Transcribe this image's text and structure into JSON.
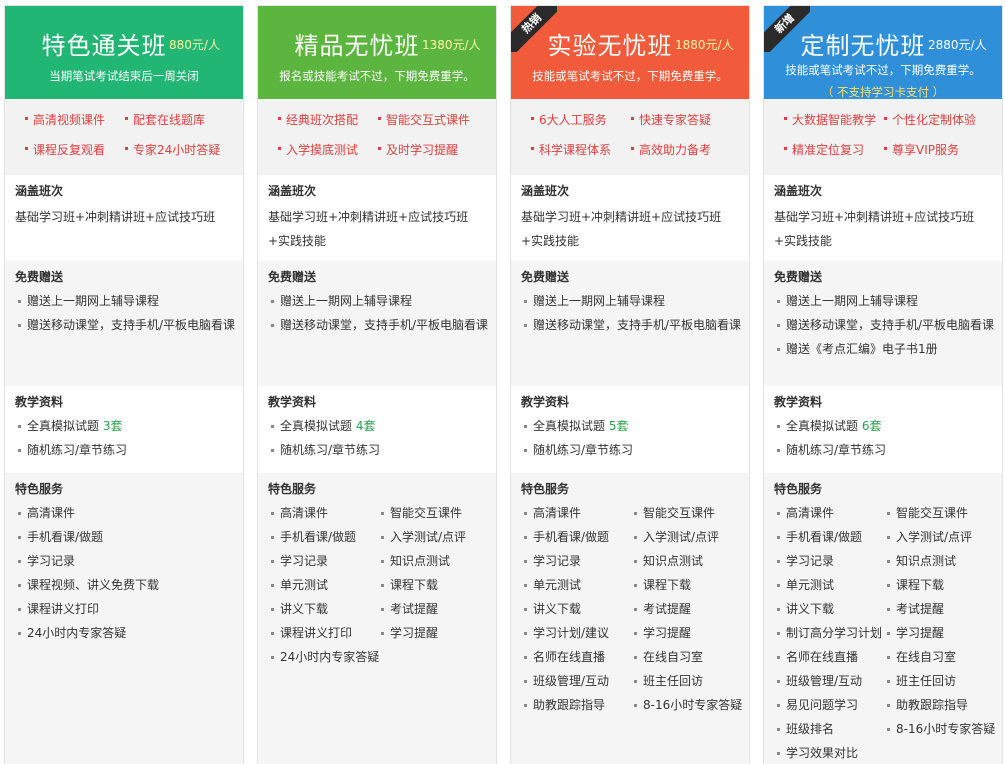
{
  "columns": [
    {
      "title": "特色通关班",
      "price": "880元/人",
      "subtitle": "当期笔试考试结束后一周关闭",
      "subtitle2": "",
      "ribbon": "",
      "features": [
        "高清视频课件",
        "配套在线题库",
        "课程反复观看",
        "专家24小时答疑"
      ],
      "cover_title": "涵盖班次",
      "cover_text": "基础学习班+冲刺精讲班+应试技巧班",
      "gift_title": "免费赠送",
      "gifts": [
        "赠送上一期网上辅导课程",
        "赠送移动课堂，支持手机/平板电脑看课"
      ],
      "material_title": "教学资料",
      "material_1_prefix": "全真模拟试题 ",
      "material_1_count": "3套",
      "material_2": "随机练习/章节练习",
      "service_title": "特色服务",
      "services_left": [
        "高清课件",
        "手机看课/做题",
        "学习记录",
        "课程视频、讲义免费下载",
        "课程讲义打印",
        "24小时内专家答疑"
      ],
      "services_right": []
    },
    {
      "title": "精品无忧班",
      "price": "1380元/人",
      "subtitle": "报名或技能考试不过，下期免费重学。",
      "subtitle2": "",
      "ribbon": "",
      "features": [
        "经典班次搭配",
        "智能交互式课件",
        "入学摸底测试",
        "及时学习提醒"
      ],
      "cover_title": "涵盖班次",
      "cover_text": "基础学习班+冲刺精讲班+应试技巧班+实践技能",
      "gift_title": "免费赠送",
      "gifts": [
        "赠送上一期网上辅导课程",
        "赠送移动课堂，支持手机/平板电脑看课"
      ],
      "material_title": "教学资料",
      "material_1_prefix": "全真模拟试题 ",
      "material_1_count": "4套",
      "material_2": "随机练习/章节练习",
      "service_title": "特色服务",
      "services_left": [
        "高清课件",
        "手机看课/做题",
        "学习记录",
        "单元测试",
        "讲义下载",
        "课程讲义打印",
        "24小时内专家答疑"
      ],
      "services_right": [
        "智能交互课件",
        "入学测试/点评",
        "知识点测试",
        "课程下载",
        "考试提醒",
        "学习提醒"
      ]
    },
    {
      "title": "实验无忧班",
      "price": "1880元/人",
      "subtitle": "技能或笔试考试不过，下期免费重学。",
      "subtitle2": "",
      "ribbon": "热销",
      "features": [
        "6大人工服务",
        "快速专家答疑",
        "科学课程体系",
        "高效助力备考"
      ],
      "cover_title": "涵盖班次",
      "cover_text": "基础学习班+冲刺精讲班+应试技巧班+实践技能",
      "gift_title": "免费赠送",
      "gifts": [
        "赠送上一期网上辅导课程",
        "赠送移动课堂，支持手机/平板电脑看课"
      ],
      "material_title": "教学资料",
      "material_1_prefix": "全真模拟试题 ",
      "material_1_count": "5套",
      "material_2": "随机练习/章节练习",
      "service_title": "特色服务",
      "services_left": [
        "高清课件",
        "手机看课/做题",
        "学习记录",
        "单元测试",
        "讲义下载",
        "学习计划/建议",
        "名师在线直播",
        "班级管理/互动",
        "助教跟踪指导"
      ],
      "services_right": [
        "智能交互课件",
        "入学测试/点评",
        "知识点测试",
        "课程下载",
        "考试提醒",
        "学习提醒",
        "在线自习室",
        "班主任回访",
        "8-16小时专家答疑"
      ]
    },
    {
      "title": "定制无忧班",
      "price": "2880元/人",
      "subtitle": "技能或笔试考试不过，下期免费重学。",
      "subtitle2": "（ 不支持学习卡支付 ）",
      "ribbon": "新增",
      "features": [
        "大数据智能教学",
        "个性化定制体验",
        "精准定位复习",
        "尊享VIP服务"
      ],
      "cover_title": "涵盖班次",
      "cover_text": "基础学习班+冲刺精讲班+应试技巧班+实践技能",
      "gift_title": "免费赠送",
      "gifts": [
        "赠送上一期网上辅导课程",
        "赠送移动课堂，支持手机/平板电脑看课",
        "赠送《考点汇编》电子书1册"
      ],
      "material_title": "教学资料",
      "material_1_prefix": "全真模拟试题 ",
      "material_1_count": "6套",
      "material_2": "随机练习/章节练习",
      "service_title": "特色服务",
      "services_left": [
        "高清课件",
        "手机看课/做题",
        "学习记录",
        "单元测试",
        "讲义下载",
        "制订高分学习计划",
        "名师在线直播",
        "班级管理/互动",
        "易见问题学习",
        "班级排名",
        "学习效果对比"
      ],
      "services_right": [
        "智能交互课件",
        "入学测试/点评",
        "知识点测试",
        "课程下载",
        "考试提醒",
        "学习提醒",
        "在线自习室",
        "班主任回访",
        "助教跟踪指导",
        "8-16小时专家答疑"
      ]
    }
  ],
  "colors": {
    "col0_header": "#22b675",
    "col1_header": "#5cb53f",
    "col2_header": "#f15a3a",
    "col3_header": "#2f8fd8",
    "feature_text": "#e04040",
    "count_green": "#2aa04a"
  }
}
